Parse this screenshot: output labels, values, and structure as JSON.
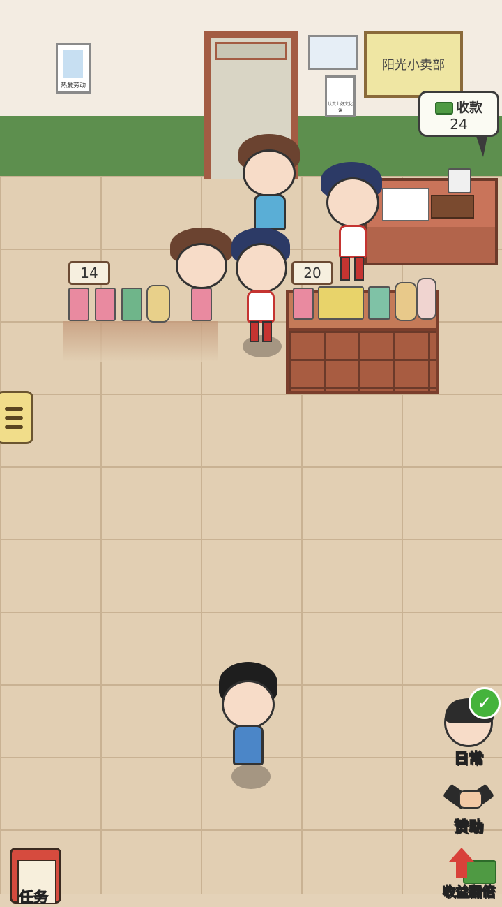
{
  "posters": {
    "labor": "热爱劳动",
    "study": "认真上好文化课"
  },
  "shop_sign": "阳光小卖部",
  "cash": {
    "label": "收款",
    "amount": "24"
  },
  "stalls": {
    "left_price": "14",
    "right_price": "20"
  },
  "side_buttons": {
    "daily": "日常",
    "sponsor": "赞助",
    "upgrade": "收益翻倍"
  },
  "bottom": {
    "tasks": "任务"
  },
  "colors": {
    "wall": "#f3ece2",
    "wainscot": "#5d8f4e",
    "floor": "#e2cfb3",
    "wood": "#b56a4d",
    "uniform_red": "#c53431",
    "check_green": "#45b33c"
  },
  "icons": [
    "money-icon",
    "menu-icon",
    "check-icon",
    "handshake-icon",
    "up-arrow-icon",
    "clipboard-icon"
  ]
}
